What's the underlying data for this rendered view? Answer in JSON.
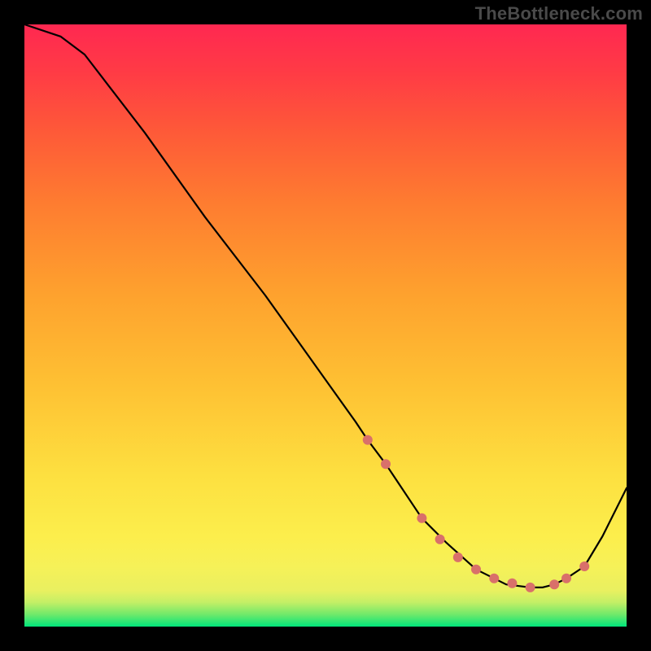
{
  "watermark": "TheBottleneck.com",
  "chart_data": {
    "type": "line",
    "title": "",
    "xlabel": "",
    "ylabel": "",
    "xlim": [
      0,
      100
    ],
    "ylim": [
      0,
      100
    ],
    "grid": false,
    "series": [
      {
        "name": "curve",
        "x": [
          0,
          6,
          10,
          20,
          30,
          40,
          50,
          55,
          57,
          60,
          62,
          66,
          70,
          75,
          80,
          84,
          86,
          88,
          90,
          93,
          96,
          100
        ],
        "values": [
          100,
          98,
          95,
          82,
          68,
          55,
          41,
          34,
          31,
          27,
          24,
          18,
          14,
          9.5,
          7,
          6.5,
          6.5,
          7,
          8,
          10,
          15,
          23
        ]
      }
    ],
    "markers": {
      "name": "salmon-dots",
      "color": "#d9706a",
      "x": [
        57,
        60,
        66,
        69,
        72,
        75,
        78,
        81,
        84,
        88,
        90,
        93
      ],
      "values": [
        31,
        27,
        18,
        14.5,
        11.5,
        9.5,
        8,
        7.2,
        6.5,
        7,
        8,
        10
      ]
    },
    "gradient_stops": [
      {
        "offset": 0.0,
        "color": "#00e57b"
      },
      {
        "offset": 0.02,
        "color": "#6fe96a"
      },
      {
        "offset": 0.04,
        "color": "#c3ef66"
      },
      {
        "offset": 0.06,
        "color": "#e9f060"
      },
      {
        "offset": 0.1,
        "color": "#f6f158"
      },
      {
        "offset": 0.15,
        "color": "#fcee4c"
      },
      {
        "offset": 0.25,
        "color": "#fde040"
      },
      {
        "offset": 0.4,
        "color": "#fec133"
      },
      {
        "offset": 0.55,
        "color": "#fea22e"
      },
      {
        "offset": 0.7,
        "color": "#fe7d30"
      },
      {
        "offset": 0.82,
        "color": "#fe5a38"
      },
      {
        "offset": 0.92,
        "color": "#ff3b45"
      },
      {
        "offset": 1.0,
        "color": "#ff2851"
      }
    ]
  }
}
